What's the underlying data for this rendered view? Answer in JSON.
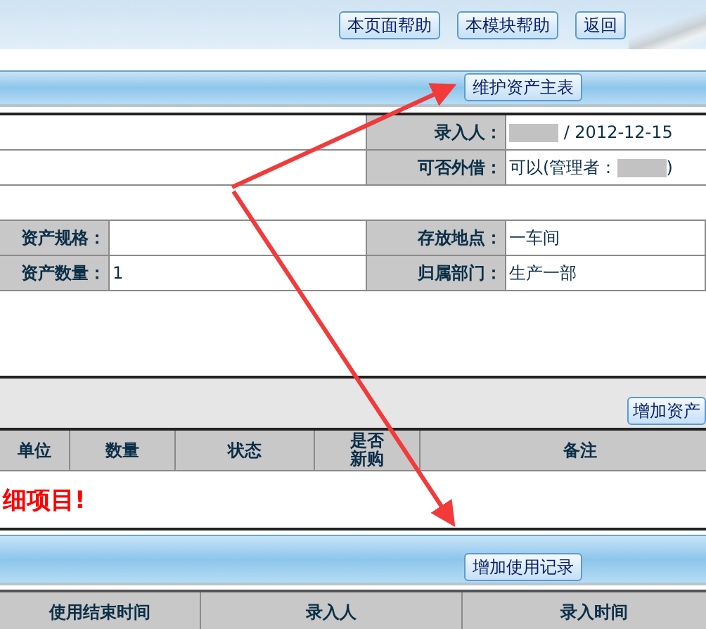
{
  "header_buttons": [
    "本页面帮助",
    "本模块帮助",
    "返回"
  ],
  "main_tab": {
    "button": "维护资产主表"
  },
  "record_fields": [
    {
      "label": "录入人：",
      "parts": [
        {
          "kind": "redacted"
        },
        {
          "kind": "text",
          "text": " / 2012-12-15"
        }
      ]
    },
    {
      "label": "可否外借：",
      "parts": [
        {
          "kind": "text",
          "text": "可以(管理者："
        },
        {
          "kind": "redacted"
        },
        {
          "kind": "text",
          "text": ")"
        }
      ]
    }
  ],
  "asset_rows": [
    [
      {
        "label": "资产规格："
      },
      {
        "label": "存放地点：",
        "value": "一车间"
      }
    ],
    [
      {
        "label": "资产数量：",
        "value": "1"
      },
      {
        "label": "归属部门：",
        "value": "生产一部"
      }
    ]
  ],
  "detail_toolbar": {
    "button": "增加资产"
  },
  "detail_table": {
    "columns": [
      "单位",
      "数量",
      "状态",
      "是否新购",
      "备注"
    ],
    "empty_message": "细项目!"
  },
  "usage_tab": {
    "button": "增加使用记录"
  },
  "usage_table": {
    "columns": [
      "使用结束时间",
      "录入人",
      "录入时间"
    ]
  }
}
